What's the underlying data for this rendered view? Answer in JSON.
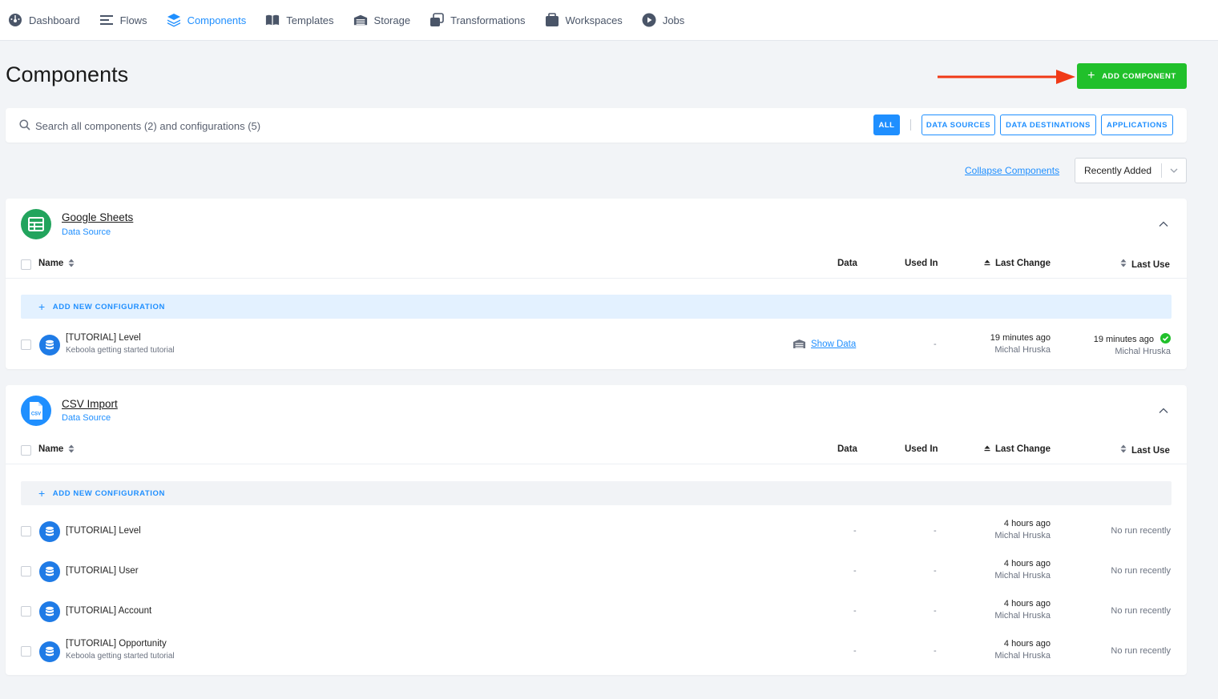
{
  "nav": [
    {
      "id": "dashboard",
      "label": "Dashboard",
      "icon": "dashboard-icon",
      "active": false
    },
    {
      "id": "flows",
      "label": "Flows",
      "icon": "flows-icon",
      "active": false
    },
    {
      "id": "components",
      "label": "Components",
      "icon": "components-icon",
      "active": true
    },
    {
      "id": "templates",
      "label": "Templates",
      "icon": "templates-icon",
      "active": false
    },
    {
      "id": "storage",
      "label": "Storage",
      "icon": "storage-icon",
      "active": false
    },
    {
      "id": "transformations",
      "label": "Transformations",
      "icon": "transformations-icon",
      "active": false
    },
    {
      "id": "workspaces",
      "label": "Workspaces",
      "icon": "workspaces-icon",
      "active": false
    },
    {
      "id": "jobs",
      "label": "Jobs",
      "icon": "jobs-icon",
      "active": false
    }
  ],
  "page": {
    "title": "Components",
    "add_button": "ADD COMPONENT"
  },
  "search": {
    "placeholder": "Search all components (2) and configurations (5)"
  },
  "filters": [
    "ALL",
    "DATA SOURCES",
    "DATA DESTINATIONS",
    "APPLICATIONS"
  ],
  "controls": {
    "collapse": "Collapse Components",
    "sort_value": "Recently Added"
  },
  "columns": {
    "name": "Name",
    "data": "Data",
    "used_in": "Used In",
    "last_change": "Last Change",
    "last_use": "Last Use"
  },
  "add_config_label": "ADD NEW CONFIGURATION",
  "components": [
    {
      "name": "Google Sheets",
      "type": "Data Source",
      "rows": [
        {
          "name": "[TUTORIAL] Level",
          "desc": "Keboola getting started tutorial",
          "data": "Show Data",
          "used_in": "-",
          "changed": "19 minutes ago",
          "changed_by": "Michal Hruska",
          "last_use": "19 minutes ago",
          "last_use_by": "Michal Hruska"
        }
      ]
    },
    {
      "name": "CSV Import",
      "type": "Data Source",
      "rows": [
        {
          "name": "[TUTORIAL] Level",
          "data": "-",
          "used_in": "-",
          "changed": "4 hours ago",
          "changed_by": "Michal Hruska",
          "last_use": "No run recently"
        },
        {
          "name": "[TUTORIAL] User",
          "data": "-",
          "used_in": "-",
          "changed": "4 hours ago",
          "changed_by": "Michal Hruska",
          "last_use": "No run recently"
        },
        {
          "name": "[TUTORIAL] Account",
          "data": "-",
          "used_in": "-",
          "changed": "4 hours ago",
          "changed_by": "Michal Hruska",
          "last_use": "No run recently"
        },
        {
          "name": "[TUTORIAL] Opportunity",
          "desc": "Keboola getting started tutorial",
          "data": "-",
          "used_in": "-",
          "changed": "4 hours ago",
          "changed_by": "Michal Hruska",
          "last_use": "No run recently"
        }
      ]
    }
  ],
  "colors": {
    "accent": "#1f8fff",
    "add_button": "#21c02b",
    "arrow": "#f03a17",
    "success": "#21c02b"
  }
}
